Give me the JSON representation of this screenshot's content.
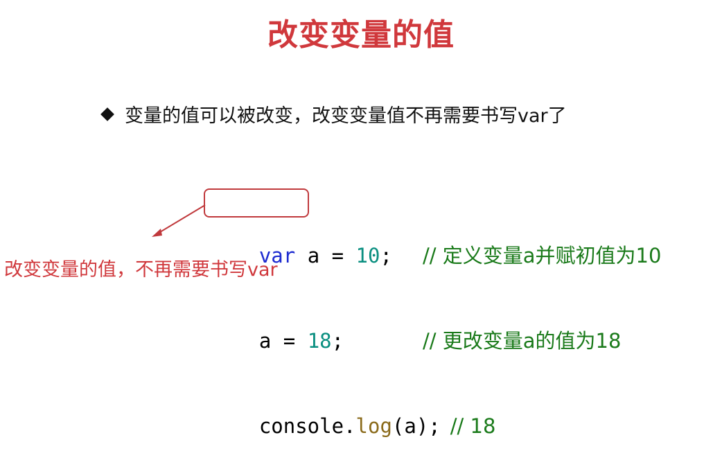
{
  "title": "改变变量的值",
  "bullet": "变量的值可以被改变，改变变量值不再需要书写var了",
  "code": {
    "line1": {
      "kw": "var",
      "name": " a = ",
      "num": "10",
      "end": ";",
      "comment": "// 定义变量a并赋初值为10"
    },
    "line2": {
      "name": "a = ",
      "num": "18",
      "end": ";",
      "comment": "// 更改变量a的值为18"
    },
    "line3": {
      "obj": "console.",
      "fn": "log",
      "args": "(a);",
      "comment": "// 18"
    }
  },
  "annotation": "改变变量的值，不再需要书写var",
  "colors": {
    "title": "#d0383c",
    "keyword": "#1d2bd0",
    "number": "#0a8f80",
    "comment": "#1a7a1a",
    "annotation": "#d0383c"
  }
}
